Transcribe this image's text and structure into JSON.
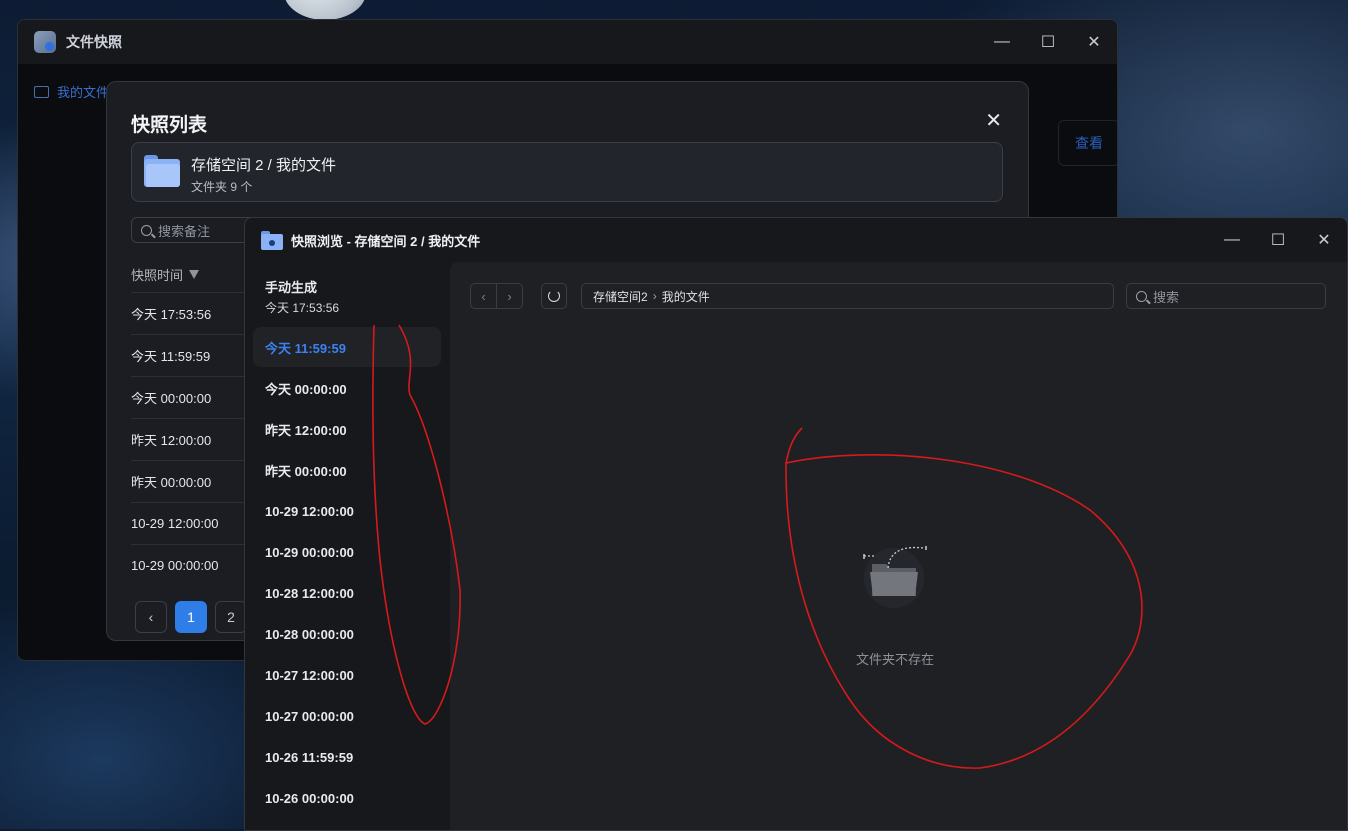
{
  "window_main": {
    "title": "文件快照",
    "sidebar_label": "我的文件",
    "view_button": "查看",
    "controls": {
      "minimize": "—",
      "maximize": "☐",
      "close": "✕"
    }
  },
  "snapshot_dialog": {
    "title": "快照列表",
    "close": "✕",
    "folder_name": "存储空间 2 / 我的文件",
    "folder_count": "文件夹 9 个",
    "search_placeholder": "搜索备注",
    "column_header": "快照时间",
    "rows": [
      "今天 17:53:56",
      "今天 11:59:59",
      "今天 00:00:00",
      "昨天 12:00:00",
      "昨天 00:00:00",
      "10-29 12:00:00",
      "10-29 00:00:00"
    ],
    "pagination": {
      "prev": "‹",
      "pages": [
        "1",
        "2"
      ],
      "current": "1"
    }
  },
  "browser_window": {
    "title": "快照浏览 - 存储空间 2 / 我的文件",
    "controls": {
      "minimize": "—",
      "maximize": "☐",
      "close": "✕"
    },
    "sidebar": {
      "first": {
        "label": "手动生成",
        "sub": "今天 17:53:56"
      },
      "items": [
        "今天 11:59:59",
        "今天 00:00:00",
        "昨天 12:00:00",
        "昨天 00:00:00",
        "10-29 12:00:00",
        "10-29 00:00:00",
        "10-28 12:00:00",
        "10-28 00:00:00",
        "10-27 12:00:00",
        "10-27 00:00:00",
        "10-26 11:59:59",
        "10-26 00:00:00"
      ],
      "active_index": 0
    },
    "toolbar": {
      "back": "‹",
      "forward": "›",
      "path_root": "存储空间2",
      "path_sep": "›",
      "path_leaf": "我的文件",
      "search_placeholder": "搜索"
    },
    "empty_message": "文件夹不存在"
  },
  "colors": {
    "accent": "#2f7de6",
    "active_text": "#3b82f0",
    "annotation": "#d61a1a"
  }
}
